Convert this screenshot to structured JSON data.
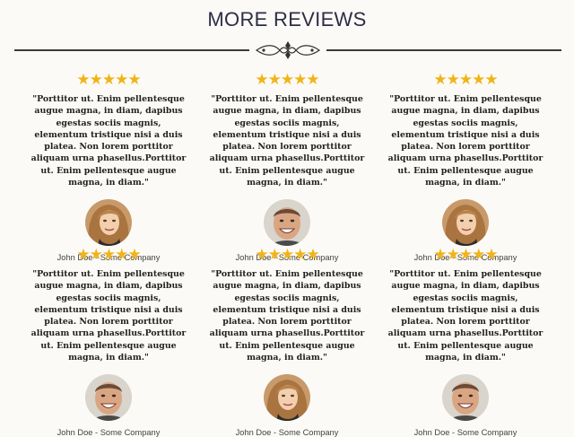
{
  "page": {
    "title": "MORE REVIEWS"
  },
  "reviews": [
    {
      "rating": 5,
      "quote": "\"Porttitor ut. Enim pellentesque augue magna, in diam, dapibus egestas sociis magnis, elementum tristique nisi a duis platea. Non lorem porttitor aliquam urna phasellus.Porttitor ut. Enim pellentesque augue magna, in diam.\"",
      "author": "John Doe - Some Company",
      "avatar": "woman"
    },
    {
      "rating": 5,
      "quote": "\"Porttitor ut. Enim pellentesque augue magna, in diam, dapibus egestas sociis magnis, elementum tristique nisi a duis platea. Non lorem porttitor aliquam urna phasellus.Porttitor ut. Enim pellentesque augue magna, in diam.\"",
      "author": "John Doe - Some Company",
      "avatar": "man"
    },
    {
      "rating": 5,
      "quote": "\"Porttitor ut. Enim pellentesque augue magna, in diam, dapibus egestas sociis magnis, elementum tristique nisi a duis platea. Non lorem porttitor aliquam urna phasellus.Porttitor ut. Enim pellentesque augue magna, in diam.\"",
      "author": "John Doe - Some Company",
      "avatar": "woman"
    },
    {
      "rating": 5,
      "quote": "\"Porttitor ut. Enim pellentesque augue magna, in diam, dapibus egestas sociis magnis, elementum tristique nisi a duis platea. Non lorem porttitor aliquam urna phasellus.Porttitor ut. Enim pellentesque augue magna, in diam.\"",
      "author": "John Doe - Some Company",
      "avatar": "man"
    },
    {
      "rating": 5,
      "quote": "\"Porttitor ut. Enim pellentesque augue magna, in diam, dapibus egestas sociis magnis, elementum tristique nisi a duis platea. Non lorem porttitor aliquam urna phasellus.Porttitor ut. Enim pellentesque augue magna, in diam.\"",
      "author": "John Doe - Some Company",
      "avatar": "woman"
    },
    {
      "rating": 5,
      "quote": "\"Porttitor ut. Enim pellentesque augue magna, in diam, dapibus egestas sociis magnis, elementum tristique nisi a duis platea. Non lorem porttitor aliquam urna phasellus.Porttitor ut. Enim pellentesque augue magna, in diam.\"",
      "author": "John Doe - Some Company",
      "avatar": "man"
    }
  ],
  "colors": {
    "star": "#f1b418",
    "title": "#2d2d45",
    "divider": "#3a3a3a"
  },
  "icons": {
    "divider_ornament": "ornament-icon",
    "star": "star-icon"
  }
}
